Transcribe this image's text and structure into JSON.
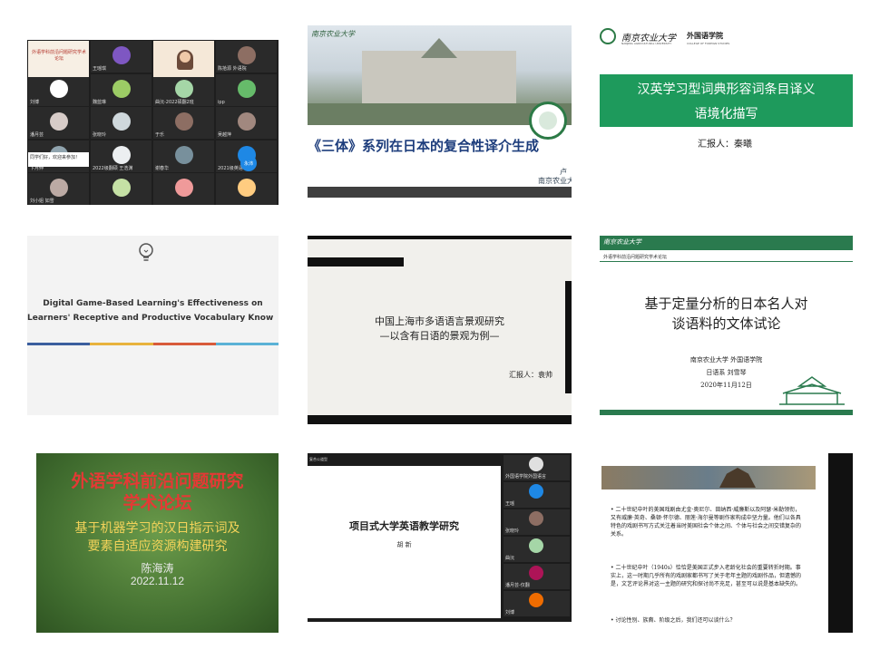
{
  "tile1": {
    "names": [
      "外语研讨 (外国语学院)",
      "王瑶琪",
      "外国语学院",
      "陈拾源 外语院",
      "刘博",
      "魏蓝琳",
      "曲沅-2022硕翻2班",
      "ipp",
      "潘月芸",
      "张晓玲",
      "于乐",
      "吴越萍",
      "卞月伸",
      "2022级翻硕 王浩渊",
      "谢春华",
      "2021级英语",
      "刘小姐 如雪",
      "",
      "",
      ""
    ],
    "slide_title": "外语学科前沿问题研究学术论坛",
    "chat_text": "同学们好，欢迎来参加！",
    "badge": "永沛"
  },
  "tile2": {
    "logo": "南京农业大学",
    "title": "《三体》系列在日本的复合性译介生成",
    "presenter": "卢",
    "school": "南京农业大"
  },
  "tile3": {
    "logo": "南京农业大学",
    "college": "外国语学院",
    "college_en": "COLLEGE OF FOREIGN STUDIES",
    "univ_en": "NANJING AGRICULTURAL UNIVERSITY",
    "title_line1": "汉英学习型词典形容词条目译义",
    "title_line2": "语境化描写",
    "reporter": "汇报人：秦曦"
  },
  "tile4": {
    "title_line1": "Digital Game-Based Learning's Effectiveness on",
    "title_line2": "Learners' Receptive and Productive Vocabulary Know",
    "stripe_colors": [
      "#3a5e9e",
      "#e8b23c",
      "#d85a3a",
      "#5ab1d6"
    ]
  },
  "tile5": {
    "title_line1": "中国上海市多语语言景观研究",
    "title_line2": "—以含有日语的景观为例—",
    "reporter": "汇报人：袁帅"
  },
  "tile6": {
    "logo": "南京农业大学",
    "forum": "外语学科前沿问题研究学术论坛",
    "title_line1": "基于定量分析的日本名人对",
    "title_line2": "谈语料的文体试论",
    "school": "南京农业大学  外国语学院",
    "dept": "日语系  刘雪琴",
    "date": "2020年11月12日"
  },
  "tile7": {
    "title_line1": "外语学科前沿问题研究",
    "title_line2": "学术论坛",
    "sub_line1": "基于机器学习的汉日指示词及",
    "sub_line2": "要素自适应资源构建研究",
    "presenter": "陈海涛",
    "date": "2022.11.12"
  },
  "tile8": {
    "title": "项目式大学英语教学研究",
    "author": "胡  新",
    "corner": "复合公道型",
    "side_names": [
      "外国语学院外国语言",
      "王瑶",
      "张晓玲",
      "曲沅",
      "潘月芸-仅翻",
      "刘博"
    ]
  },
  "tile9": {
    "bullet1": "二十世纪中叶的美国戏剧由尤金·奥尼尔、田纳西·威廉斯以及阿瑟·米勒领衔，又有威廉·英奇、桑顿·怀尔德、丽莲·海尔曼等剧作家构成中坚力量。他们以各具特色的戏剧书写方式关注着当时美国社会个体之间、个体与社会之间交错复杂的关系。",
    "bullet2": "二十世纪中叶（1940s）恰恰是美国正式步入老龄化社会的重要转折时期。事实上，这一时期几乎所有的戏剧家都书写了关于老年主题的戏剧作品，但遗憾的是，文艺评论界对这一主题的研究和探讨尚不充足，甚至可以说是基本缺失的。",
    "bullet3": "讨论性别、族裔、阶级之后，我们还可以谈什么？"
  }
}
